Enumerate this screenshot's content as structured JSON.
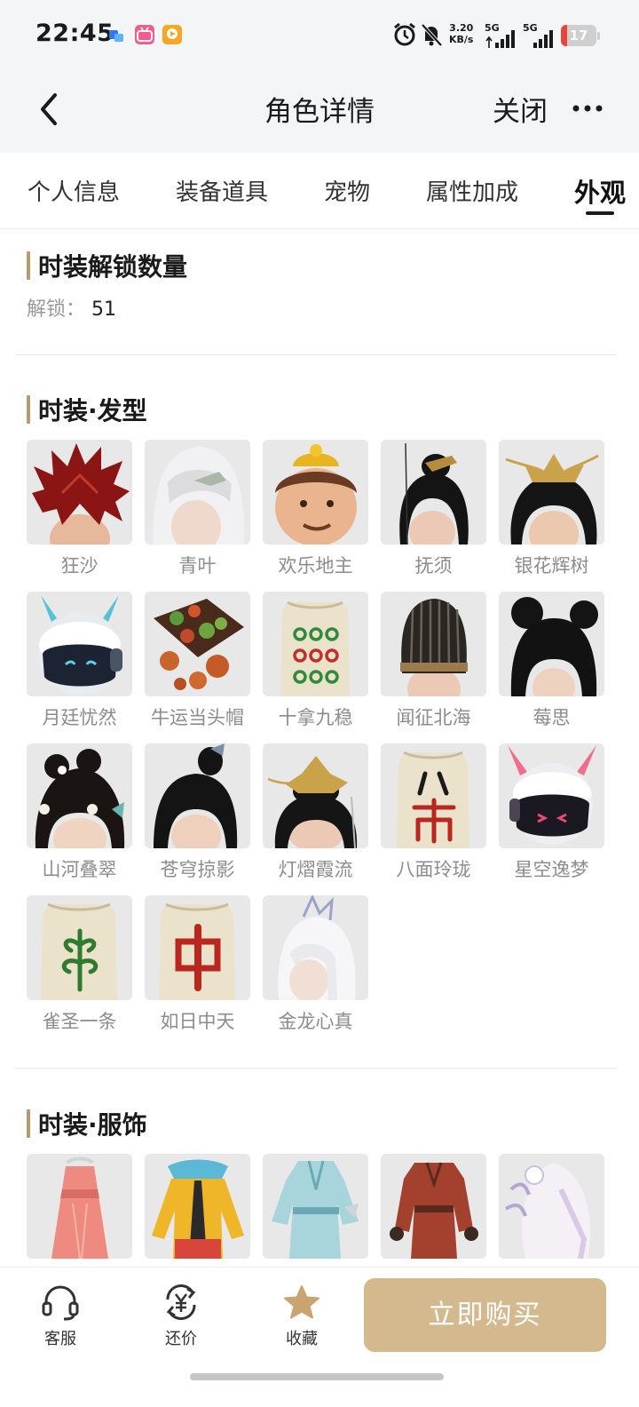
{
  "status_bar": {
    "time": "22:45",
    "net_speed_value": "3.20",
    "net_speed_unit": "KB/s",
    "sim1": "5G",
    "sim2": "5G",
    "battery": "17",
    "battery_level": 0.17,
    "battery_color": "#e9443a",
    "icons": [
      "app-notification-icon",
      "bilibili-icon",
      "video-app-icon",
      "alarm-icon",
      "mute-icon",
      "signal-icon",
      "battery-icon"
    ]
  },
  "header": {
    "title": "角色详情",
    "close": "关闭",
    "back_icon": "chevron-left-icon",
    "more_icon": "more-dots-icon"
  },
  "tabs": [
    {
      "label": "个人信息",
      "active": false
    },
    {
      "label": "装备道具",
      "active": false
    },
    {
      "label": "宠物",
      "active": false
    },
    {
      "label": "属性加成",
      "active": false
    },
    {
      "label": "外观",
      "active": true
    }
  ],
  "unlock_section": {
    "title": "时装解锁数量",
    "label": "解锁：",
    "count": "51"
  },
  "hair_section": {
    "title": "时装·发型",
    "items": [
      {
        "name": "狂沙",
        "icon": "spiky-red-hair"
      },
      {
        "name": "青叶",
        "icon": "silver-hair"
      },
      {
        "name": "欢乐地主",
        "icon": "landlord-hat"
      },
      {
        "name": "抚须",
        "icon": "black-topknot"
      },
      {
        "name": "银花辉树",
        "icon": "gold-crown-hair"
      },
      {
        "name": "月廷忧然",
        "icon": "visor-helmet"
      },
      {
        "name": "牛运当头帽",
        "icon": "fruit-hat"
      },
      {
        "name": "十拿九稳",
        "icon": "mahjong-sack"
      },
      {
        "name": "闻征北海",
        "icon": "official-hat"
      },
      {
        "name": "莓思",
        "icon": "black-buns-hair"
      },
      {
        "name": "山河叠翠",
        "icon": "flower-buns-hair"
      },
      {
        "name": "苍穹掠影",
        "icon": "black-bun-hair"
      },
      {
        "name": "灯熠霞流",
        "icon": "phoenix-crown"
      },
      {
        "name": "八面玲珑",
        "icon": "mahjong-sack-wan"
      },
      {
        "name": "星空逸梦",
        "icon": "pink-visor-helmet"
      },
      {
        "name": "雀圣一条",
        "icon": "mahjong-sack-bamboo"
      },
      {
        "name": "如日中天",
        "icon": "mahjong-sack-zhong"
      },
      {
        "name": "金龙心真",
        "icon": "white-long-hair"
      }
    ]
  },
  "costume_section": {
    "title": "时装·服饰",
    "items": [
      {
        "icon": "pink-dress"
      },
      {
        "icon": "yellow-outfit"
      },
      {
        "icon": "blue-robe"
      },
      {
        "icon": "red-armor"
      },
      {
        "icon": "white-gown"
      }
    ]
  },
  "bottom_bar": {
    "service": "客服",
    "bargain": "还价",
    "favorite": "收藏",
    "buy": "立即购买",
    "accent": "#d4b98f"
  }
}
